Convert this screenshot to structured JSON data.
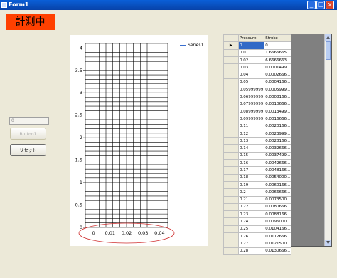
{
  "window": {
    "title": "Form1",
    "minimize": "_",
    "maximize": "□",
    "close": "x"
  },
  "status_label": "計測中",
  "textbox": {
    "value": "0"
  },
  "buttons": {
    "button1": "Button1",
    "reset": "リセット"
  },
  "chart_data": {
    "type": "line",
    "title": "",
    "xlabel": "",
    "ylabel": "",
    "categories": [
      "0",
      "0.01",
      "0.02",
      "0.03",
      "0.04"
    ],
    "y_ticks": [
      "4",
      "3.5",
      "3",
      "2.5",
      "2",
      "1.5",
      "1",
      "0.5",
      "0"
    ],
    "xlim": [
      -0.005,
      0.045
    ],
    "ylim": [
      0,
      4.1
    ],
    "grid": true,
    "legend": "top-right",
    "series": [
      {
        "name": "Series1",
        "x": [],
        "y": []
      }
    ],
    "colors": {
      "series": "#3a6fd0",
      "grid": "#000000",
      "annotation": "#d03030"
    }
  },
  "table": {
    "columns": [
      "Pressure",
      "Stroke"
    ],
    "rows": [
      [
        "0",
        "0"
      ],
      [
        "0.01",
        "1.6666665..."
      ],
      [
        "0.02",
        "6.6666663..."
      ],
      [
        "0.03",
        "0.0001499..."
      ],
      [
        "0.04",
        "0.0002666..."
      ],
      [
        "0.05",
        "0.0004166..."
      ],
      [
        "0.05999999",
        "0.0005999..."
      ],
      [
        "0.06999999",
        "0.0008166..."
      ],
      [
        "0.07999999",
        "0.0010666..."
      ],
      [
        "0.08999999",
        "0.0013499..."
      ],
      [
        "0.09999999",
        "0.0016666..."
      ],
      [
        "0.11",
        "0.0020166..."
      ],
      [
        "0.12",
        "0.0023999..."
      ],
      [
        "0.13",
        "0.0028166..."
      ],
      [
        "0.14",
        "0.0032666..."
      ],
      [
        "0.15",
        "0.0037499..."
      ],
      [
        "0.16",
        "0.0042666..."
      ],
      [
        "0.17",
        "0.0048166..."
      ],
      [
        "0.18",
        "0.0054000..."
      ],
      [
        "0.19",
        "0.0060166..."
      ],
      [
        "0.2",
        "0.0066666..."
      ],
      [
        "0.21",
        "0.0073500..."
      ],
      [
        "0.22",
        "0.0080666..."
      ],
      [
        "0.23",
        "0.0088166..."
      ],
      [
        "0.24",
        "0.0096000..."
      ],
      [
        "0.25",
        "0.0104166..."
      ],
      [
        "0.26",
        "0.0112666..."
      ],
      [
        "0.27",
        "0.0121500..."
      ],
      [
        "0.28",
        "0.0130666..."
      ]
    ]
  }
}
